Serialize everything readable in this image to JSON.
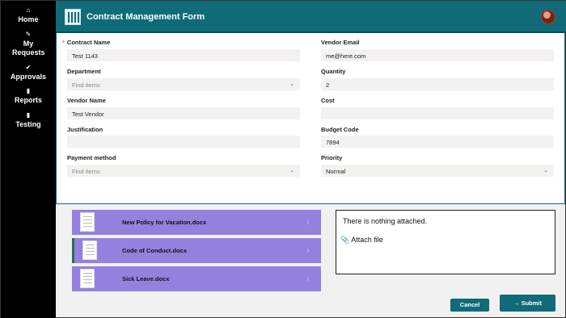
{
  "sidebar": {
    "items": [
      {
        "icon": "home-icon",
        "label": "Home"
      },
      {
        "icon": "pencil-icon",
        "label": "My Requests"
      },
      {
        "icon": "check-circle-icon",
        "label": "Approvals"
      },
      {
        "icon": "document-icon",
        "label": "Reports"
      },
      {
        "icon": "document-icon",
        "label": "Testing"
      }
    ]
  },
  "header": {
    "title": "Contract Management Form",
    "color": "#0f6b77"
  },
  "form": {
    "contract_name": {
      "label": "Contract Name",
      "required": "*",
      "value": "Test 1143"
    },
    "department": {
      "label": "Department",
      "placeholder": "Find items"
    },
    "vendor_name": {
      "label": "Vendor Name",
      "value": "Test Vendor"
    },
    "justification": {
      "label": "Justification",
      "value": ""
    },
    "payment_method": {
      "label": "Payment method",
      "placeholder": "Find items"
    },
    "vendor_email": {
      "label": "Vendor Email",
      "value": "me@here.com"
    },
    "quantity": {
      "label": "Quantity",
      "value": "2"
    },
    "cost": {
      "label": "Cost",
      "value": ""
    },
    "budget_code": {
      "label": "Budget Code",
      "value": "7894"
    },
    "priority": {
      "label": "Priority",
      "value": "Normal"
    }
  },
  "documents": [
    {
      "name": "New Policy for Vacation.docx"
    },
    {
      "name": "Code of Conduct.docx"
    },
    {
      "name": "Sick Leave.docx"
    }
  ],
  "attachments": {
    "empty_text": "There is nothing attached.",
    "attach_label": "Attach file"
  },
  "actions": {
    "cancel": "Cancel",
    "submit": "Submit"
  },
  "colors": {
    "accent": "#0f6b77",
    "card": "#9481df",
    "sidebar": "#000000"
  }
}
